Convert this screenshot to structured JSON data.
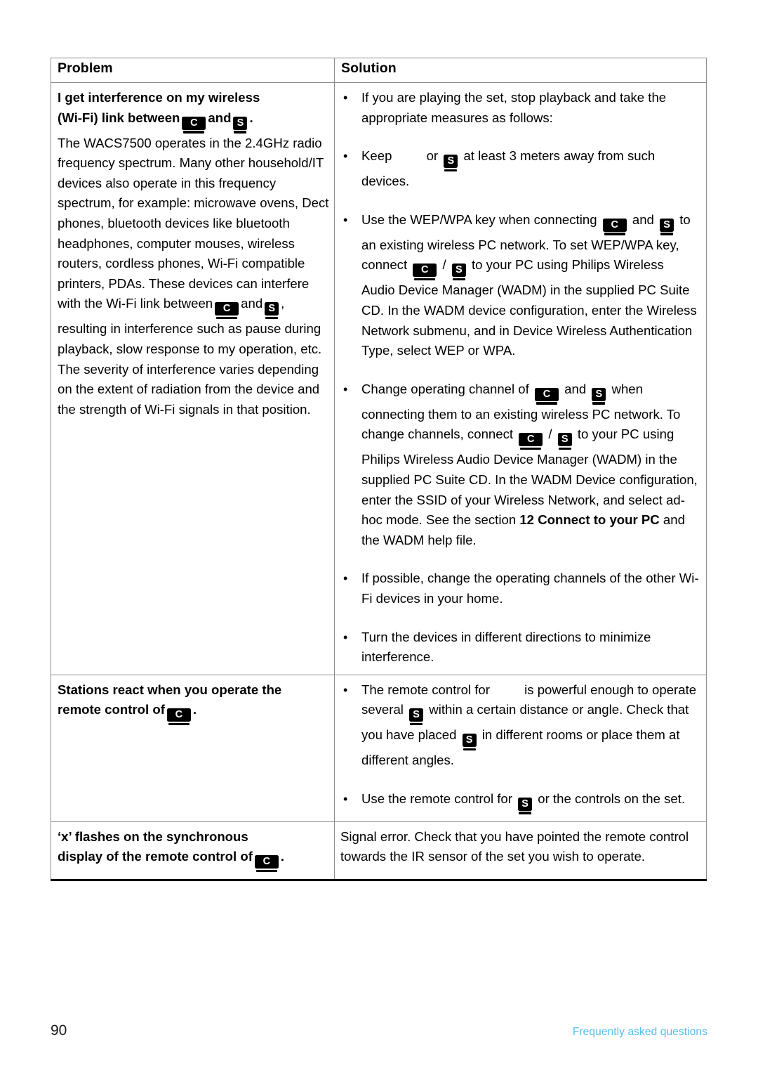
{
  "document": {
    "page_number": "90",
    "footer_section": "Frequently asked questions",
    "footer_color": "#56bdf0"
  },
  "icons": {
    "center": {
      "name": "center-device-icon",
      "letter": "C"
    },
    "station": {
      "name": "station-device-icon",
      "letter": "S"
    }
  },
  "table": {
    "headers": {
      "problem": "Problem",
      "solution": "Solution"
    },
    "rows": [
      {
        "problem": {
          "bold_lead_1": "I get interference on my wireless",
          "bold_lead_2a": "(Wi-Fi) link between",
          "bold_lead_2b": "and",
          "bold_lead_2c": ".",
          "body_1": "The WACS7500 operates in the 2.4GHz radio frequency spectrum. Many other household/IT devices also operate in this frequency spectrum, for example: microwave ovens, Dect phones, bluetooth devices like bluetooth headphones, computer mouses, wireless routers, cordless phones, Wi-Fi compatible printers, PDAs. These devices can interfere with the Wi-Fi link between",
          "body_2": "and",
          "body_3": ", resulting in interference such as pause during playback, slow response to my operation, etc. The severity of interference varies depending on the extent of radiation from the device and the strength of Wi-Fi signals in that position."
        },
        "solution_bullets": [
          {
            "segments": [
              {
                "type": "text",
                "value": "If you are playing the set, stop playback and take the appropriate measures as follows:"
              }
            ]
          },
          {
            "segments": [
              {
                "type": "text",
                "value": "Keep"
              },
              {
                "type": "blank"
              },
              {
                "type": "text",
                "value": "or"
              },
              {
                "type": "icon",
                "value": "station"
              },
              {
                "type": "text",
                "value": "at least 3 meters away from such devices."
              }
            ]
          },
          {
            "segments": [
              {
                "type": "text",
                "value": "Use the WEP/WPA key when connecting"
              },
              {
                "type": "icon",
                "value": "center"
              },
              {
                "type": "text",
                "value": "and"
              },
              {
                "type": "icon",
                "value": "station"
              },
              {
                "type": "text",
                "value": "to an existing wireless PC network. To set WEP/WPA key, connect"
              },
              {
                "type": "icon",
                "value": "center"
              },
              {
                "type": "text",
                "value": "/"
              },
              {
                "type": "icon",
                "value": "station"
              },
              {
                "type": "text",
                "value": "to your PC using Philips Wireless Audio Device Manager (WADM) in the supplied PC Suite CD. In the WADM device configuration, enter the Wireless Network submenu, and in Device Wireless Authentication Type, select WEP or WPA."
              }
            ]
          },
          {
            "segments": [
              {
                "type": "text",
                "value": "Change operating channel of"
              },
              {
                "type": "icon",
                "value": "center"
              },
              {
                "type": "text",
                "value": "and"
              },
              {
                "type": "icon",
                "value": "station"
              },
              {
                "type": "text",
                "value": "when connecting them to an existing wireless PC network. To change channels, connect"
              },
              {
                "type": "icon",
                "value": "center"
              },
              {
                "type": "text",
                "value": "/"
              },
              {
                "type": "icon",
                "value": "station"
              },
              {
                "type": "text",
                "value": "to your PC using Philips Wireless Audio Device Manager (WADM) in the supplied PC Suite CD. In the WADM Device configuration, enter the SSID of your Wireless Network, and select ad-hoc mode. See the section"
              },
              {
                "type": "bold",
                "value": "12 Connect to your PC"
              },
              {
                "type": "text",
                "value": "and the WADM help file."
              }
            ]
          },
          {
            "segments": [
              {
                "type": "text",
                "value": "If possible, change the operating channels of the other Wi-Fi devices in your home."
              }
            ]
          },
          {
            "segments": [
              {
                "type": "text",
                "value": "Turn the devices in different directions to minimize interference."
              }
            ]
          }
        ]
      },
      {
        "problem": {
          "bold_lead_1": "Stations react when you operate the",
          "bold_lead_2a": "remote control of",
          "bold_lead_2c": "."
        },
        "solution_bullets": [
          {
            "segments": [
              {
                "type": "text",
                "value": "The remote control for"
              },
              {
                "type": "blank"
              },
              {
                "type": "text",
                "value": "is powerful enough to operate several"
              },
              {
                "type": "icon",
                "value": "station"
              },
              {
                "type": "text",
                "value": "within a certain distance or angle. Check that you have placed"
              },
              {
                "type": "icon",
                "value": "station"
              },
              {
                "type": "text",
                "value": "in different rooms or place them at different angles."
              }
            ]
          },
          {
            "segments": [
              {
                "type": "text",
                "value": "Use the remote control for"
              },
              {
                "type": "icon",
                "value": "station"
              },
              {
                "type": "text",
                "value": "or the controls on the set."
              }
            ]
          }
        ]
      },
      {
        "problem": {
          "bold_lead_1": "‘x’ flashes on the synchronous",
          "bold_lead_2a": "display of the remote control of",
          "bold_lead_2c": "."
        },
        "solution_plain": "Signal error. Check that you have pointed the remote control towards the IR sensor of the set you wish to operate."
      }
    ]
  }
}
